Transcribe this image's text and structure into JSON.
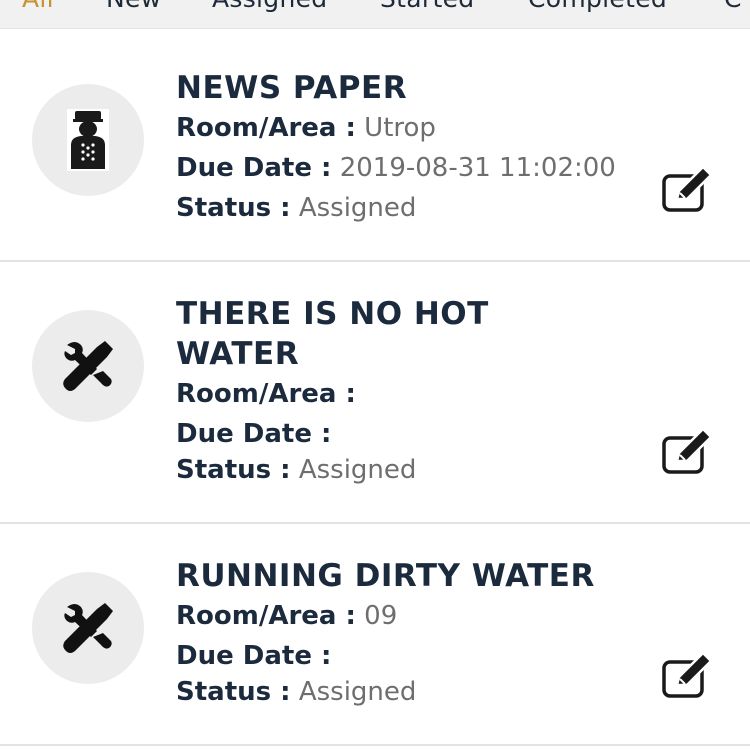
{
  "tabs": [
    {
      "label": "All",
      "active": true
    },
    {
      "label": "New",
      "active": false
    },
    {
      "label": "Assigned",
      "active": false
    },
    {
      "label": "Started",
      "active": false
    },
    {
      "label": "Completed",
      "active": false
    },
    {
      "label": "C",
      "active": false
    }
  ],
  "labels": {
    "room": "Room/Area :",
    "due": "Due Date :",
    "status": "Status :"
  },
  "tasks": [
    {
      "title": "NEWS PAPER",
      "room": "Utrop",
      "due": "2019-08-31 11:02:00",
      "status": "Assigned",
      "icon": "bellboy-icon"
    },
    {
      "title": "THERE IS NO HOT WATER",
      "room": "",
      "due": "",
      "status": "Assigned",
      "icon": "tools-icon"
    },
    {
      "title": "RUNNING DIRTY WATER",
      "room": "09",
      "due": "",
      "status": "Assigned",
      "icon": "tools-icon"
    }
  ],
  "colors": {
    "accent": "#c8922e",
    "text_dark": "#1b2a3d",
    "text_muted": "#6e6e6e",
    "avatar_bg": "#ececec",
    "tab_bar_bg": "#f1f1f1"
  }
}
